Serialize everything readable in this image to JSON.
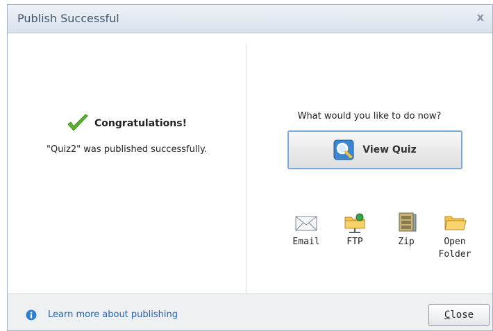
{
  "dialog": {
    "title": "Publish Successful",
    "close_glyph": "x"
  },
  "left": {
    "congrats": "Congratulations!",
    "published_message": "\"Quiz2\" was published successfully."
  },
  "right": {
    "question": "What would you like to do now?",
    "view_quiz_label": "View Quiz",
    "actions": [
      {
        "label": "Email",
        "icon": "envelope-icon"
      },
      {
        "label": "FTP",
        "icon": "ftp-folder-icon"
      },
      {
        "label": "Zip",
        "icon": "zip-archive-icon"
      },
      {
        "label_line1": "Open",
        "label_line2": "Folder",
        "icon": "folder-icon"
      }
    ]
  },
  "footer": {
    "learn_more": "Learn more about publishing",
    "close_first_letter": "C",
    "close_rest": "lose"
  },
  "colors": {
    "title_text": "#44546a",
    "link": "#1e64b4",
    "button_border": "#7aa9d6",
    "check_green": "#5ab52e"
  }
}
